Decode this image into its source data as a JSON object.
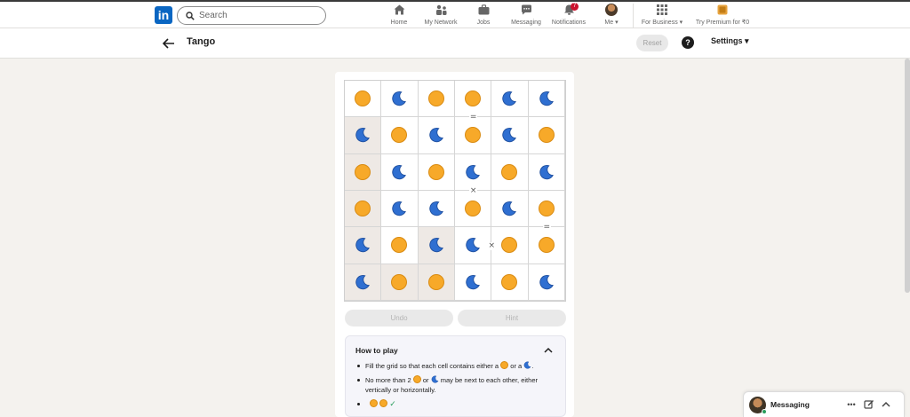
{
  "nav": {
    "search_placeholder": "Search",
    "items": [
      {
        "label": "Home",
        "icon": "home-icon"
      },
      {
        "label": "My Network",
        "icon": "network-icon"
      },
      {
        "label": "Jobs",
        "icon": "jobs-icon"
      },
      {
        "label": "Messaging",
        "icon": "messaging-icon"
      },
      {
        "label": "Notifications",
        "icon": "bell-icon",
        "badge": "7"
      },
      {
        "label": "Me ▾",
        "icon": "avatar"
      },
      {
        "label": "For Business ▾",
        "icon": "grid-icon"
      },
      {
        "label": "Try Premium for ₹0",
        "icon": "premium-icon"
      }
    ]
  },
  "header": {
    "title": "Tango",
    "reset_label": "Reset",
    "help_label": "?",
    "settings_label": "Settings ▾"
  },
  "board": {
    "rows": [
      [
        "sun",
        "moon",
        "sun",
        "sun",
        "moon",
        "moon"
      ],
      [
        "moon",
        "sun",
        "moon",
        "sun",
        "moon",
        "sun"
      ],
      [
        "sun",
        "moon",
        "sun",
        "moon",
        "sun",
        "moon"
      ],
      [
        "sun",
        "moon",
        "moon",
        "sun",
        "moon",
        "sun"
      ],
      [
        "moon",
        "sun",
        "moon",
        "moon",
        "sun",
        "sun"
      ],
      [
        "moon",
        "sun",
        "sun",
        "moon",
        "sun",
        "moon"
      ]
    ],
    "locked": [
      [
        1,
        0
      ],
      [
        2,
        0
      ],
      [
        3,
        0
      ],
      [
        4,
        0
      ],
      [
        5,
        0
      ],
      [
        4,
        2
      ],
      [
        5,
        1
      ],
      [
        5,
        2
      ]
    ],
    "markers": [
      {
        "symbol": "=",
        "between": [
          [
            0,
            3
          ],
          [
            1,
            3
          ]
        ]
      },
      {
        "symbol": "×",
        "between": [
          [
            2,
            3
          ],
          [
            3,
            3
          ]
        ]
      },
      {
        "symbol": "×",
        "between": [
          [
            4,
            3
          ],
          [
            4,
            4
          ]
        ]
      },
      {
        "symbol": "=",
        "between": [
          [
            3,
            5
          ],
          [
            4,
            5
          ]
        ]
      }
    ],
    "colors": {
      "sun": "#f7a929",
      "moon": "#2f6fd1"
    }
  },
  "controls": {
    "undo_label": "Undo",
    "hint_label": "Hint"
  },
  "how_to_play": {
    "title": "How to play",
    "rule1_prefix": "Fill the grid so that each cell contains either a",
    "rule1_mid": "or a",
    "rule1_suffix": ".",
    "rule2_prefix": "No more than 2",
    "rule2_mid": "or",
    "rule2_suffix": "may be next to each other, either vertically or horizontally.",
    "example_check": "✓"
  },
  "messaging": {
    "title": "Messaging"
  }
}
